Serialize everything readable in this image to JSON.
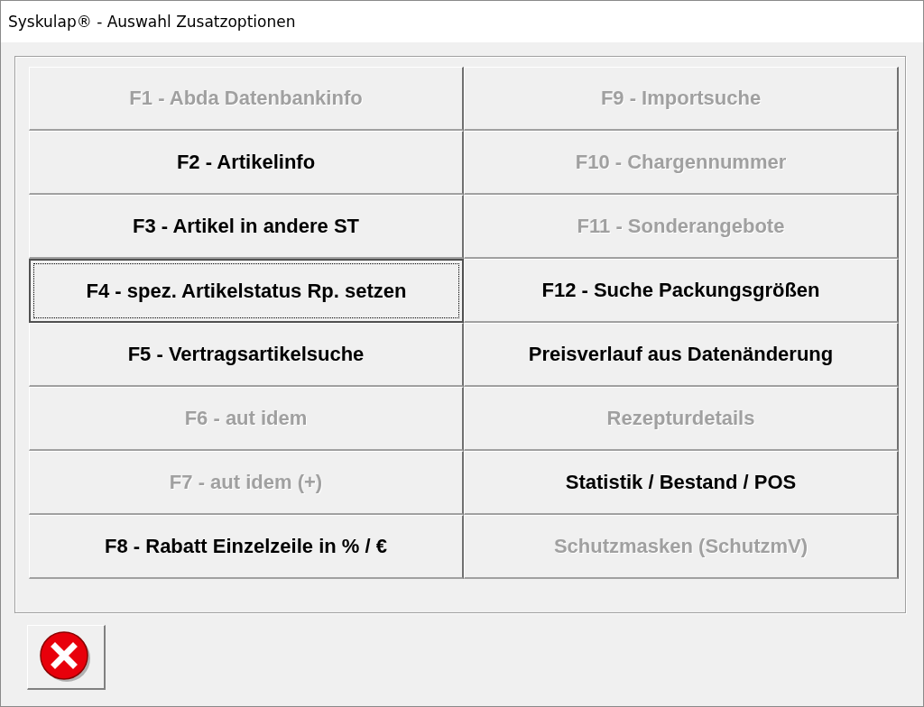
{
  "window": {
    "title": "Syskulap® - Auswahl Zusatzoptionen"
  },
  "options": [
    {
      "label": "F1 - Abda Datenbankinfo",
      "disabled": true,
      "focused": false
    },
    {
      "label": "F2 - Artikelinfo",
      "disabled": false,
      "focused": false
    },
    {
      "label": "F3 - Artikel in andere ST",
      "disabled": false,
      "focused": false
    },
    {
      "label": "F4 - spez. Artikelstatus Rp. setzen",
      "disabled": false,
      "focused": true
    },
    {
      "label": "F5 - Vertragsartikelsuche",
      "disabled": false,
      "focused": false
    },
    {
      "label": "F6 - aut idem",
      "disabled": true,
      "focused": false
    },
    {
      "label": "F7 - aut idem (+)",
      "disabled": true,
      "focused": false
    },
    {
      "label": "F8 - Rabatt Einzelzeile in % / €",
      "disabled": false,
      "focused": false
    },
    {
      "label": "F9 - Importsuche",
      "disabled": true,
      "focused": false
    },
    {
      "label": "F10 - Chargennummer",
      "disabled": true,
      "focused": false
    },
    {
      "label": "F11 - Sonderangebote",
      "disabled": true,
      "focused": false
    },
    {
      "label": "F12 - Suche Packungsgrößen",
      "disabled": false,
      "focused": false
    },
    {
      "label": "Preisverlauf aus Datenänderung",
      "disabled": false,
      "focused": false
    },
    {
      "label": "Rezepturdetails",
      "disabled": true,
      "focused": false
    },
    {
      "label": "Statistik / Bestand / POS",
      "disabled": false,
      "focused": false
    },
    {
      "label": "Schutzmasken (SchutzmV)",
      "disabled": true,
      "focused": false
    }
  ]
}
